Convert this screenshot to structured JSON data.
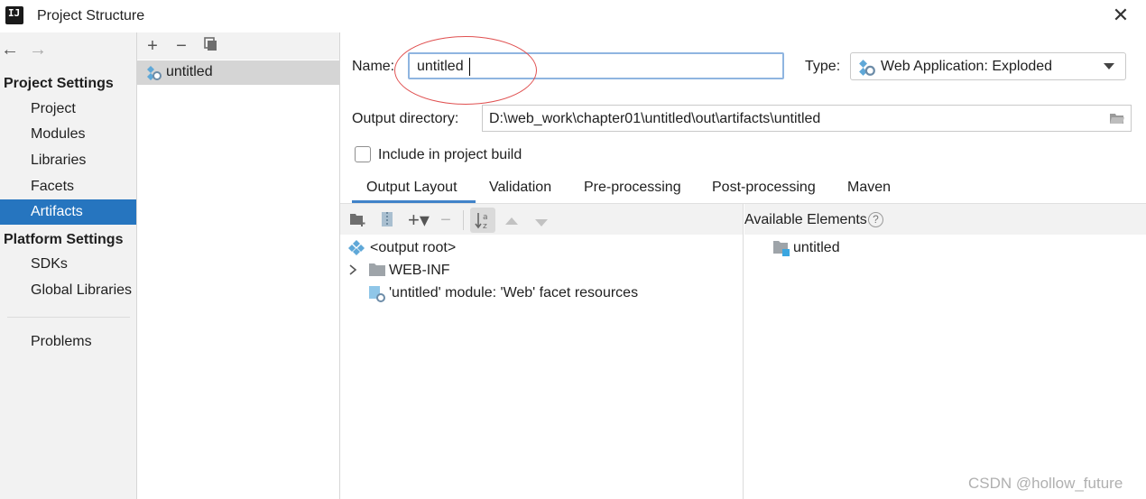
{
  "window": {
    "title": "Project Structure",
    "app_icon": "intellij-idea-icon",
    "close_icon": "close-icon"
  },
  "nav": {
    "back_icon": "back-arrow-icon",
    "forward_icon": "forward-arrow-icon"
  },
  "sidebar": {
    "project_settings_header": "Project Settings",
    "project_settings_items": [
      "Project",
      "Modules",
      "Libraries",
      "Facets",
      "Artifacts"
    ],
    "selected_item": "Artifacts",
    "platform_settings_header": "Platform Settings",
    "platform_settings_items": [
      "SDKs",
      "Global Libraries"
    ],
    "problems": "Problems"
  },
  "artifact_list": {
    "toolbar": [
      "add-icon",
      "remove-icon",
      "copy-icon"
    ],
    "items": [
      "untitled"
    ]
  },
  "form": {
    "name_label": "Name:",
    "name_value": "untitled",
    "type_label": "Type:",
    "type_value": "Web Application: Exploded",
    "output_dir_label": "Output directory:",
    "output_dir_value": "D:\\web_work\\chapter01\\untitled\\out\\artifacts\\untitled",
    "include_label": "Include in project build",
    "include_checked": false
  },
  "tabs": [
    "Output Layout",
    "Validation",
    "Pre-processing",
    "Post-processing",
    "Maven"
  ],
  "active_tab": "Output Layout",
  "layout_toolbar": [
    "new-folder-icon",
    "archive-icon",
    "add-icon",
    "remove-icon",
    "sort-icon",
    "move-up-icon",
    "move-down-icon"
  ],
  "output_tree": {
    "root": "<output root>",
    "children": [
      "WEB-INF",
      "'untitled' module: 'Web' facet resources"
    ]
  },
  "available": {
    "header": "Available Elements",
    "help": "?",
    "items": [
      "untitled"
    ]
  },
  "watermark": "CSDN @hollow_future",
  "colors": {
    "selection": "#2675bf",
    "annotation_circle": "#e05050",
    "focus_border": "#8fb5e0"
  }
}
